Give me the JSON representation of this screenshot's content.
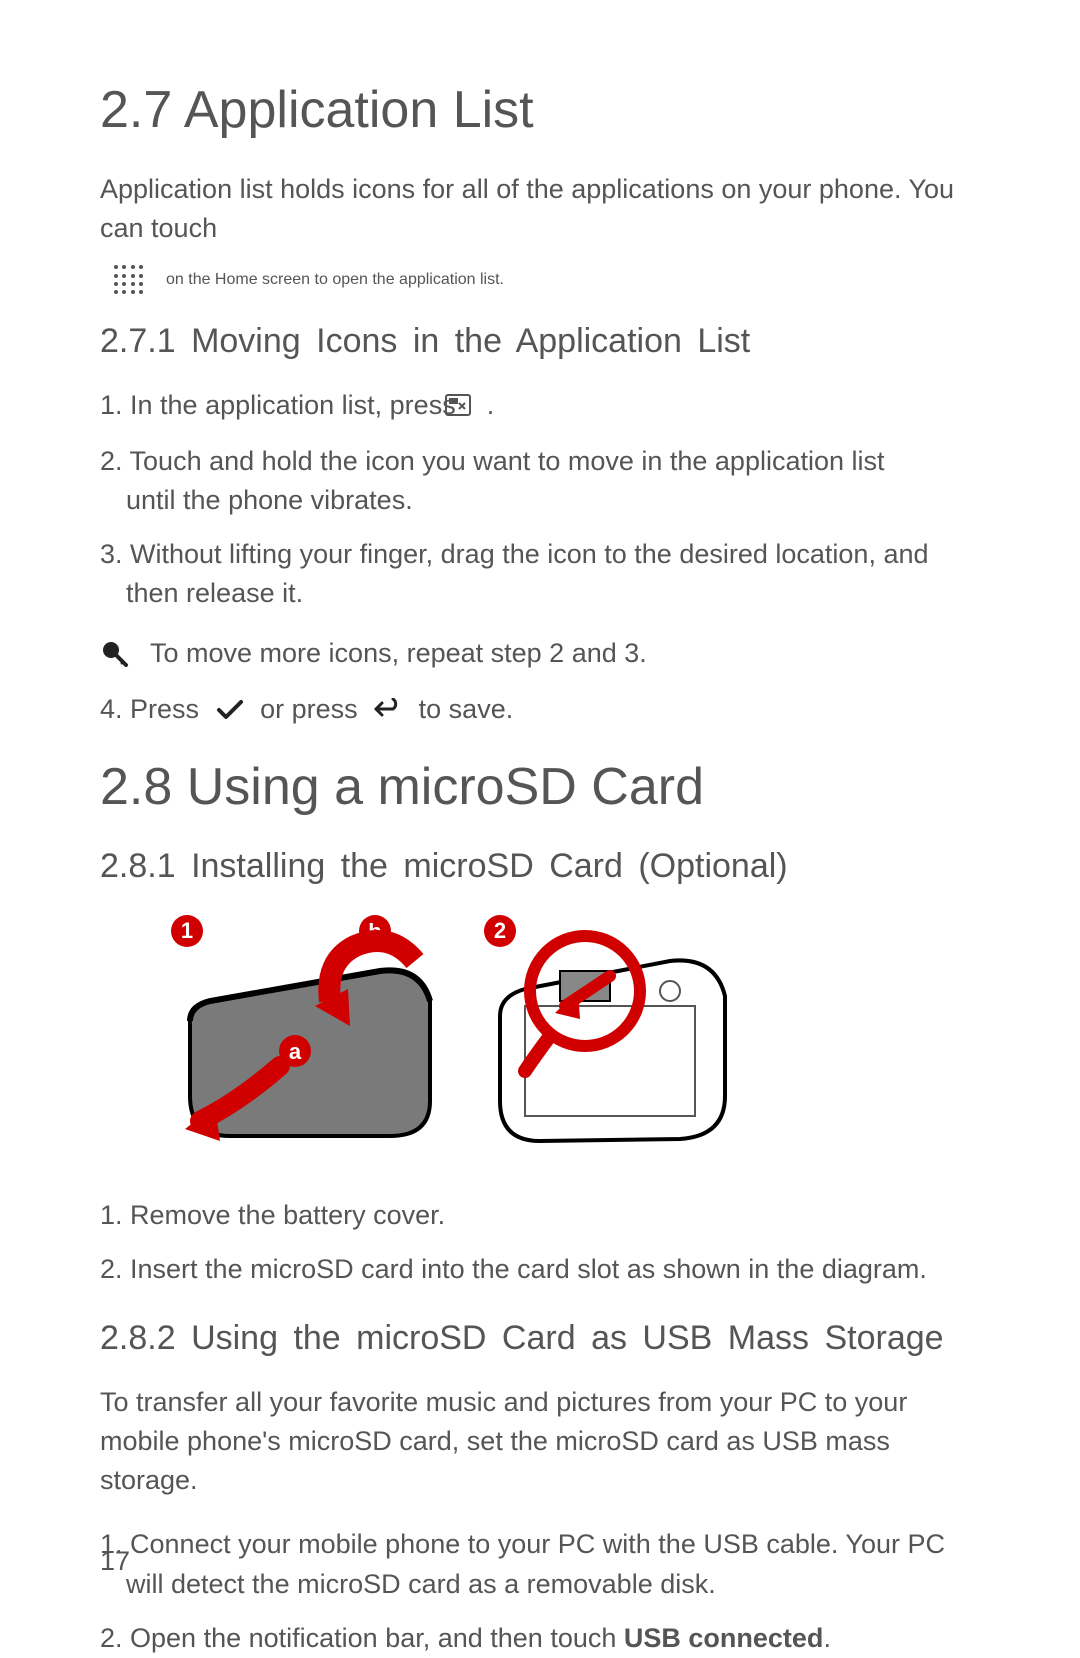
{
  "section27": {
    "title": "2.7  Application List",
    "intro": "Application list holds icons for all of the applications on your phone. You can touch",
    "intro_cont": "on the Home screen to open the application list."
  },
  "section271": {
    "title": "2.7.1  Moving Icons in the Application List",
    "step1_a": "1. In the application list, press",
    "step1_b": ".",
    "step2": "2. Touch and hold the icon you want to move in the application list until the phone vibrates.",
    "step3": "3. Without lifting your finger, drag the icon to the desired location, and then release it.",
    "note": "To move more icons, repeat step 2 and 3.",
    "step4_a": "4. Press",
    "step4_b": "or press",
    "step4_c": "to save."
  },
  "section28": {
    "title": "2.8  Using a microSD Card"
  },
  "section281": {
    "title": "2.8.1  Installing the microSD Card (Optional)",
    "step1": "1. Remove the battery cover.",
    "step2": "2. Insert the microSD card into the card slot as shown in the diagram."
  },
  "section282": {
    "title": "2.8.2  Using the microSD Card as USB Mass Storage",
    "intro": "To transfer all your favorite music and pictures from your PC to your mobile phone's microSD card, set the microSD card as USB mass storage.",
    "step1": "1. Connect your mobile phone to your PC with the USB cable. Your PC will detect the microSD card as a removable disk.",
    "step2_a": "2. Open the notification bar, and then touch ",
    "step2_b": "USB connected",
    "step2_c": "."
  },
  "page_number": "17"
}
